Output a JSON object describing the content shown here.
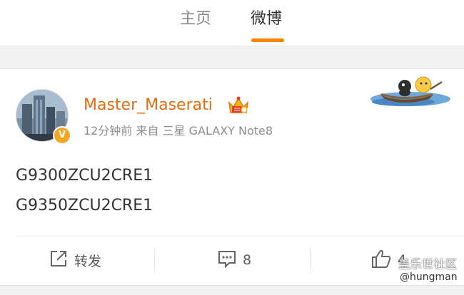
{
  "nav": {
    "tabs": [
      {
        "label": "主页",
        "active": false
      },
      {
        "label": "微博",
        "active": true
      }
    ],
    "accent_color": "#ff8200"
  },
  "post": {
    "author": {
      "name": "Master_Maserati",
      "verified": true,
      "name_color": "#e86b0c",
      "badge_icon": "crown-icon",
      "avatar_icon": "city-skyline-avatar"
    },
    "meta": "12分钟前 来自 三星 GALAXY Note8",
    "content_lines": [
      "G9300ZCU2CRE1",
      "G9350ZCU2CRE1"
    ],
    "decoration_icon": "boat-sticker-icon"
  },
  "actions": {
    "repost": {
      "icon": "repost-icon",
      "label": "转发"
    },
    "comment": {
      "icon": "comment-icon",
      "count": "8"
    },
    "like": {
      "icon": "thumbs-up-icon",
      "count": "4"
    }
  },
  "watermark": {
    "title": "盖乐世社区",
    "handle": "@hungman"
  }
}
